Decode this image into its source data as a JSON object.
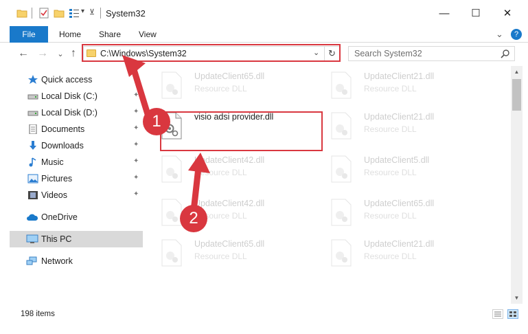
{
  "window": {
    "title": "System32",
    "minimize": "—",
    "maximize": "☐",
    "close": "✕"
  },
  "ribbon": {
    "tabs": [
      "File",
      "Home",
      "Share",
      "View"
    ],
    "expand": "⌄",
    "help": "?"
  },
  "navigation": {
    "back": "←",
    "forward": "→",
    "recent": "⌄",
    "up": "↑"
  },
  "address": {
    "path": "C:\\Windows\\System32",
    "dropdown": "⌄",
    "refresh": "↻"
  },
  "search": {
    "placeholder": "Search System32"
  },
  "sidebar": {
    "items": [
      {
        "label": "Quick access",
        "icon": "star-icon",
        "pinned": false
      },
      {
        "label": "Local Disk (C:)",
        "icon": "drive-icon",
        "pinned": true
      },
      {
        "label": "Local Disk (D:)",
        "icon": "drive-icon",
        "pinned": true
      },
      {
        "label": "Documents",
        "icon": "documents-icon",
        "pinned": true
      },
      {
        "label": "Downloads",
        "icon": "download-icon",
        "pinned": true
      },
      {
        "label": "Music",
        "icon": "music-icon",
        "pinned": true
      },
      {
        "label": "Pictures",
        "icon": "pictures-icon",
        "pinned": true
      },
      {
        "label": "Videos",
        "icon": "videos-icon",
        "pinned": true
      },
      {
        "label": "OneDrive",
        "icon": "cloud-icon",
        "pinned": false
      },
      {
        "label": "This PC",
        "icon": "computer-icon",
        "pinned": false,
        "selected": true
      },
      {
        "label": "Network",
        "icon": "network-icon",
        "pinned": false
      }
    ],
    "pin_glyph": "📌"
  },
  "files": [
    {
      "name": "UpdateClient65.dll",
      "type": "Resource DLL",
      "faded": true
    },
    {
      "name": "UpdateClient21.dll",
      "type": "Resource DLL",
      "faded": true
    },
    {
      "name": "visio adsi provider.dll",
      "type": "",
      "faded": false
    },
    {
      "name": "UpdateClient21.dll",
      "type": "Resource DLL",
      "faded": true
    },
    {
      "name": "UpdateClient42.dll",
      "type": "Resource DLL",
      "faded": true
    },
    {
      "name": "UpdateClient5.dll",
      "type": "Resource DLL",
      "faded": true
    },
    {
      "name": "UpdateClient42.dll",
      "type": "Resource DLL",
      "faded": true
    },
    {
      "name": "UpdateClient65.dll",
      "type": "Resource DLL",
      "faded": true
    },
    {
      "name": "UpdateClient65.dll",
      "type": "Resource DLL",
      "faded": true
    },
    {
      "name": "UpdateClient21.dll",
      "type": "Resource DLL",
      "faded": true
    }
  ],
  "status": {
    "item_count": "198 items"
  },
  "annotations": {
    "step1": "1",
    "step2": "2",
    "color": "#d9373f"
  }
}
